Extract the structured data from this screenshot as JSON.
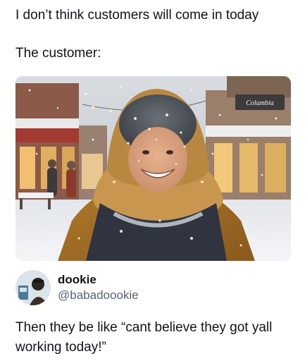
{
  "meme": {
    "line1": "I don’t think customers will come in today",
    "line2": "The customer:"
  },
  "photo": {
    "store_sign": "Columbia"
  },
  "tweet": {
    "display_name": "dookie",
    "handle": "@babadoookie",
    "text": "Then they be like “cant believe they got yall working today!”"
  }
}
